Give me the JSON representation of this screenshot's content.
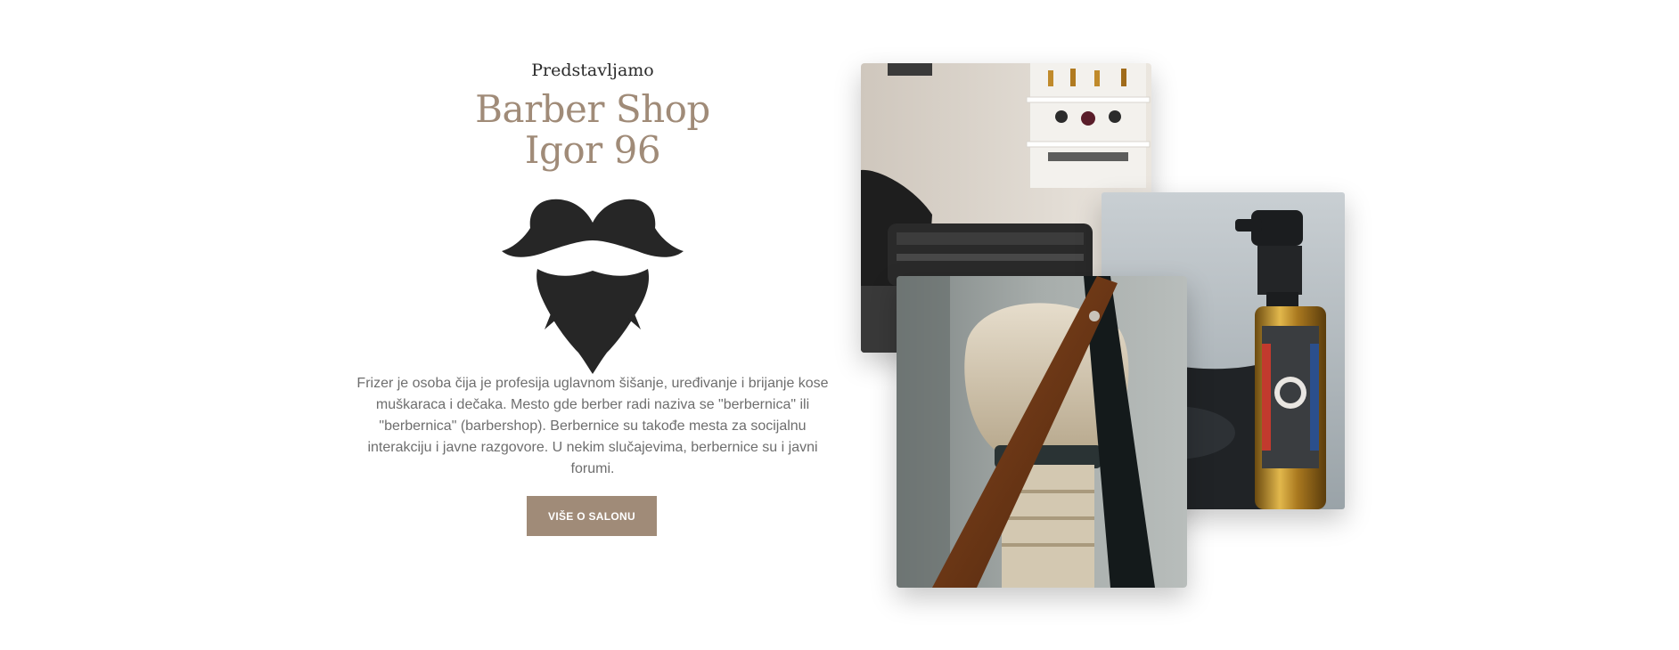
{
  "intro": {
    "eyebrow": "Predstavljamo",
    "title_line1": "Barber Shop",
    "title_line2": "Igor 96",
    "description": "Frizer je osoba čija je profesija uglavnom šišanje, uređivanje i brijanje kose muškaraca i dečaka. Mesto gde berber radi naziva se \"berbernica\" ili \"berbernica\" (barbershop). Berbernice su takođe mesta za socijalnu interakciju i javne razgovore. U nekim slučajevima, berbernice su i javni forumi.",
    "button_label": "VIŠE O SALONU"
  },
  "icons": {
    "beard": "beard-mustache-icon"
  },
  "colors": {
    "accent": "#a08b78",
    "heading": "#2a2a2a",
    "body_text": "#6e6e6e",
    "icon": "#262626"
  },
  "photos": [
    {
      "subject": "barber-shop-interior-photo"
    },
    {
      "subject": "hair-spray-bottle-photo"
    },
    {
      "subject": "shaving-brush-and-razor-photo"
    }
  ]
}
